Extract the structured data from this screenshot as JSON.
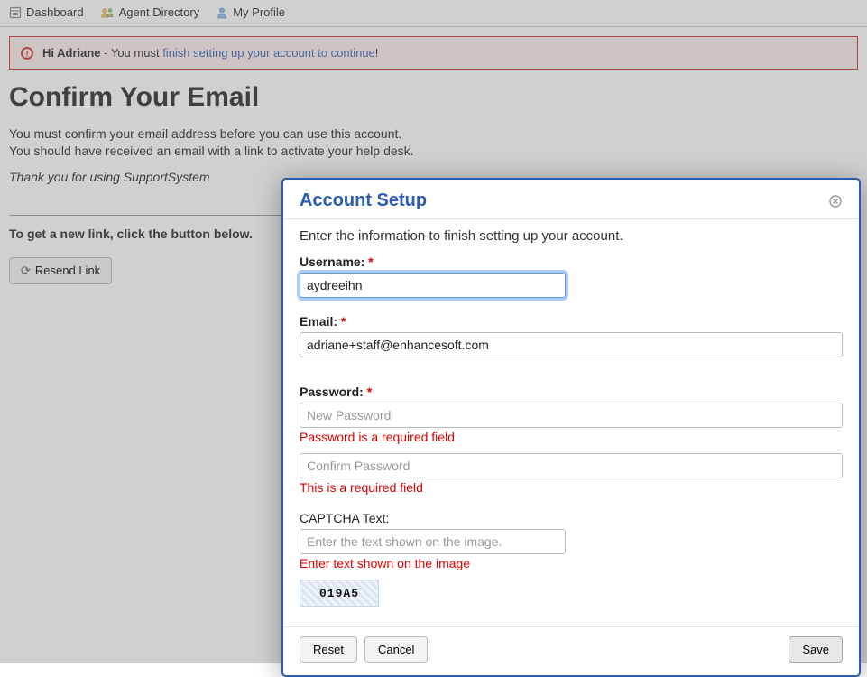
{
  "topnav": {
    "items": [
      {
        "label": "Dashboard"
      },
      {
        "label": "Agent Directory"
      },
      {
        "label": "My Profile"
      }
    ]
  },
  "alert": {
    "greeting": "Hi Adriane",
    "mid": " - You must ",
    "link": "finish setting up your account to continue",
    "tail": "!"
  },
  "page": {
    "title": "Confirm Your Email",
    "line1": "You must confirm your email address before you can use this account.",
    "line2": "You should have received an email with a link to activate your help desk.",
    "thanks": "Thank you for using SupportSystem",
    "instruction": "To get a new link, click the button below.",
    "resend_label": "Resend Link"
  },
  "modal": {
    "title": "Account Setup",
    "subhead": "Enter the information to finish setting up your account.",
    "username": {
      "label": "Username:",
      "value": "aydreeihn"
    },
    "email": {
      "label": "Email:",
      "value": "adriane+staff@enhancesoft.com"
    },
    "password": {
      "label": "Password:",
      "new_placeholder": "New Password",
      "confirm_placeholder": "Confirm Password",
      "err_new": "Password is a required field",
      "err_confirm": "This is a required field"
    },
    "captcha": {
      "label": "CAPTCHA Text:",
      "placeholder": "Enter the text shown on the image.",
      "err": "Enter text shown on the image",
      "img_text": "019A5"
    },
    "buttons": {
      "reset": "Reset",
      "cancel": "Cancel",
      "save": "Save"
    }
  }
}
